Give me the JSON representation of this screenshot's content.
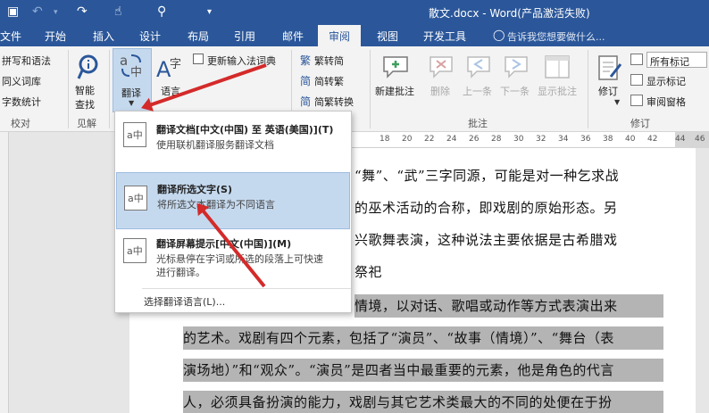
{
  "window": {
    "title": "散文.docx - Word(产品激活失败)"
  },
  "tabs": [
    {
      "label": "文件"
    },
    {
      "label": "开始"
    },
    {
      "label": "插入"
    },
    {
      "label": "设计"
    },
    {
      "label": "布局"
    },
    {
      "label": "引用"
    },
    {
      "label": "邮件"
    },
    {
      "label": "审阅"
    },
    {
      "label": "视图"
    },
    {
      "label": "开发工具"
    }
  ],
  "tell_me": "告诉我您想要做什么...",
  "ribbon": {
    "proofing": {
      "spelling": "拼写和语法",
      "thesaurus": "同义词库",
      "wordcount": "字数统计",
      "group": "校对"
    },
    "insights": {
      "smart_lookup_1": "智能",
      "smart_lookup_2": "查找",
      "group": "见解"
    },
    "language": {
      "translate": "翻译",
      "language": "语言",
      "update_ime": "更新输入法词典"
    },
    "chinese": {
      "to_simplified": "繁转简",
      "to_traditional": "简转繁",
      "convert": "简繁转换"
    },
    "comments": {
      "new": "新建批注",
      "delete": "删除",
      "previous": "上一条",
      "next": "下一条",
      "show": "显示批注",
      "group": "批注"
    },
    "tracking": {
      "track": "修订",
      "markup_select": "所有标记",
      "show_markup": "显示标记",
      "review_pane": "审阅窗格",
      "group": "修订"
    }
  },
  "ruler": {
    "numbers": [
      "18",
      "20",
      "22",
      "24",
      "26",
      "28",
      "30",
      "32",
      "34",
      "36",
      "38",
      "40",
      "42",
      "44",
      "46"
    ]
  },
  "document": {
    "lines": [
      "“舞”、“武”三字同源，可能是对一种乞求战",
      "的巫术活动的合称，即戏剧的原始形态。另",
      "兴歌舞表演，这种说法主要依据是古希腊戏",
      "祭祀",
      "情境，以对话、歌唱或动作等方式表演出来",
      "的艺术。戏剧有四个元素，包括了“演员”、“故事（情境）”、“舞台（表",
      "演场地）”和“观众”。“演员”是四者当中最重要的元素，他是角色的代言",
      "人，必须具备扮演的能力，戏剧与其它艺术类最大的不同的处便在于扮"
    ]
  },
  "translate_menu": {
    "items": [
      {
        "title": "翻译文档[中文(中国) 至 英语(美国)](T)",
        "desc": [
          "使用联机翻译服务翻译文档"
        ]
      },
      {
        "title": "翻译所选文字(S)",
        "desc": [
          "将所选文本翻译为不同语言"
        ]
      },
      {
        "title": "翻译屏幕提示[中文(中国)](M)",
        "desc": [
          "光标悬停在字词或所选的段落上可快速",
          "进行翻译。"
        ]
      }
    ],
    "footer": "选择翻译语言(L)..."
  },
  "colors": {
    "title_bar": "#2b579a",
    "ribbon_bg": "#f3f3f3",
    "menu_highlight": "#c5d9ee",
    "arrow": "#d42a2a",
    "selection": "#b4b4b4"
  }
}
